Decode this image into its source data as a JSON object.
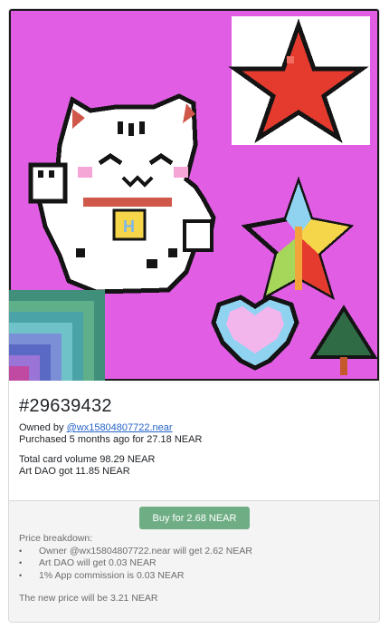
{
  "token": {
    "id": "#29639432",
    "owned_by_label": "Owned by",
    "owner": "@wx15804807722.near",
    "purchased": "Purchased 5 months ago for 27.18 NEAR",
    "total_volume": "Total card volume 98.29 NEAR",
    "art_dao_got": "Art DAO got 11.85 NEAR"
  },
  "buy": {
    "label": "Buy for 2.68 NEAR"
  },
  "breakdown": {
    "title": "Price breakdown:",
    "items": [
      "Owner @wx15804807722.near will get 2.62 NEAR",
      "Art DAO will get 0.03 NEAR",
      "1% App commission is 0.03 NEAR"
    ],
    "new_price": "The new price will be 3.21 NEAR"
  },
  "colors": {
    "background": "#e15ee4",
    "buy_button": "#6fae85",
    "link": "#2563c9"
  },
  "icons": [
    "star-icon",
    "lucky-cat-icon",
    "heart-icon",
    "pinwheel-star-icon",
    "pine-tree-icon"
  ]
}
